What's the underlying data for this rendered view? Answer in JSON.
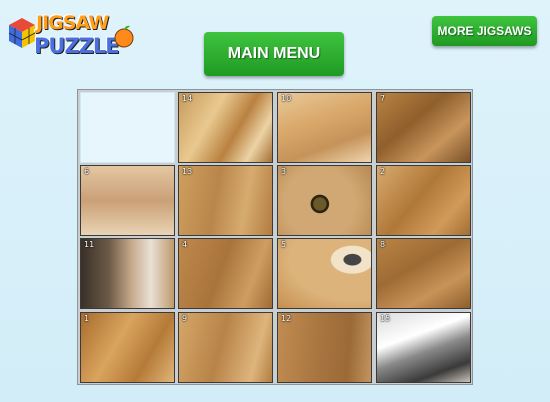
{
  "logo": {
    "line1": "JIGSAW",
    "line2": "PUZZLE"
  },
  "buttons": {
    "main_menu": "MAIN MENU",
    "more_jigsaws": "MORE JIGSAWS"
  },
  "colors": {
    "button_green": "#2fb52f",
    "background": "#d8f0fa"
  },
  "puzzle": {
    "rows": [
      [
        null,
        "14",
        "10",
        "7"
      ],
      [
        "6",
        "13",
        "3",
        "2"
      ],
      [
        "11",
        "4",
        "5",
        "8"
      ],
      [
        "1",
        "9",
        "12",
        "15"
      ]
    ]
  }
}
